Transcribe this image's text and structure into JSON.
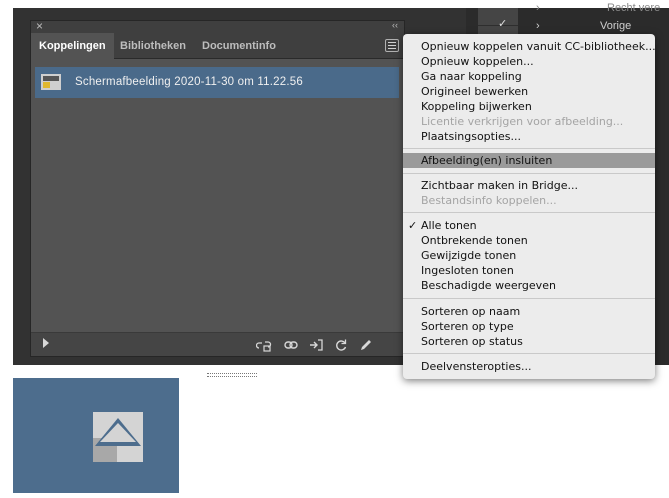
{
  "panel": {
    "tabs": [
      {
        "label": "Koppelingen",
        "active": true
      },
      {
        "label": "Bibliotheken",
        "active": false
      },
      {
        "label": "Documentinfo",
        "active": false
      }
    ],
    "links": [
      {
        "name": "Schermafbeelding 2020-11-30 om 11.22.56",
        "selected": true
      }
    ],
    "bottom_icons": [
      "relink-from-cc-icon",
      "relink-chain-icon",
      "go-to-link-icon",
      "update-link-icon",
      "edit-original-icon"
    ]
  },
  "right_panel": {
    "items": [
      {
        "label": "Recht vere",
        "icon": "chevron-right-icon"
      },
      {
        "label": "Vorige",
        "icon": "chevron-right-icon"
      }
    ]
  },
  "menu": {
    "groups": [
      [
        {
          "label": "Opnieuw koppelen vanuit CC-bibliotheek...",
          "enabled": true
        },
        {
          "label": "Opnieuw koppelen...",
          "enabled": true
        },
        {
          "label": "Ga naar koppeling",
          "enabled": true
        },
        {
          "label": "Origineel bewerken",
          "enabled": true
        },
        {
          "label": "Koppeling bijwerken",
          "enabled": true
        },
        {
          "label": "Licentie verkrijgen voor afbeelding...",
          "enabled": false
        },
        {
          "label": "Plaatsingsopties...",
          "enabled": true
        }
      ],
      [
        {
          "label": "Afbeelding(en) insluiten",
          "enabled": true,
          "highlighted": true
        }
      ],
      [
        {
          "label": "Zichtbaar maken in Bridge...",
          "enabled": true
        },
        {
          "label": "Bestandsinfo koppelen...",
          "enabled": false
        }
      ],
      [
        {
          "label": "Alle tonen",
          "enabled": true,
          "checked": true
        },
        {
          "label": "Ontbrekende tonen",
          "enabled": true
        },
        {
          "label": "Gewijzigde tonen",
          "enabled": true
        },
        {
          "label": "Ingesloten tonen",
          "enabled": true
        },
        {
          "label": "Beschadigde weergeven",
          "enabled": true
        }
      ],
      [
        {
          "label": "Sorteren op naam",
          "enabled": true
        },
        {
          "label": "Sorteren op type",
          "enabled": true
        },
        {
          "label": "Sorteren op status",
          "enabled": true
        }
      ],
      [
        {
          "label": "Deelvensteropties...",
          "enabled": true
        }
      ]
    ]
  },
  "embed_icon": {
    "name": "embed-image-icon",
    "background": "#4d6d8d"
  },
  "colors": {
    "selection": "#4a6a8a",
    "menu_highlight": "#9a9a9a",
    "panel_bg": "#535353"
  }
}
